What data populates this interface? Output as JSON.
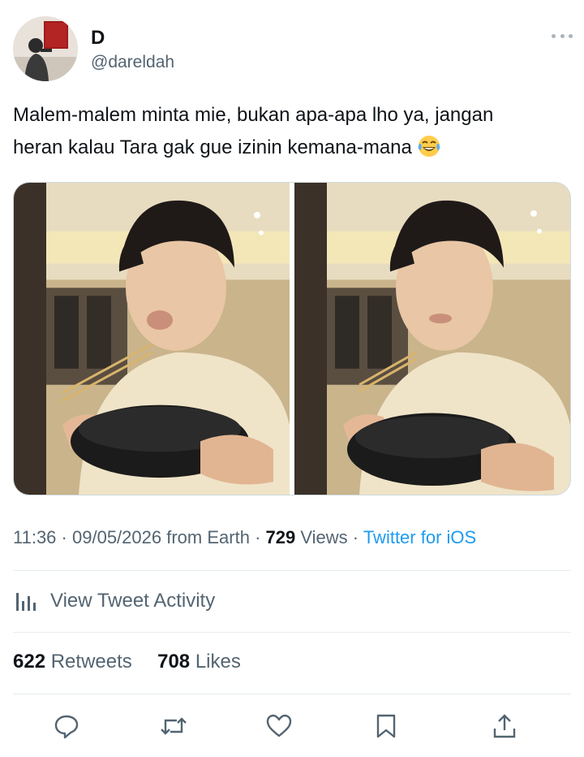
{
  "tweet": {
    "author": {
      "display_name": "D",
      "handle": "@dareldah"
    },
    "text_line1": "Malem-malem minta mie, bukan apa-apa lho ya, jangan",
    "text_line2": "heran kalau Tara gak gue izinin kemana-mana",
    "emoji": "face-with-tears-of-joy",
    "time": "11:36",
    "date": "09/05/2026",
    "location": "from Earth",
    "views_count": "729",
    "views_label": "Views",
    "source": "Twitter for iOS",
    "activity_label": "View Tweet Activity",
    "retweets_count": "622",
    "retweets_label": "Retweets",
    "likes_count": "708",
    "likes_label": "Likes"
  },
  "icons": {
    "more": "more-horizontal-icon",
    "activity": "analytics-bars-icon",
    "reply": "reply-bubble-icon",
    "retweet": "retweet-icon",
    "like": "heart-icon",
    "bookmark": "bookmark-icon",
    "share": "share-icon"
  },
  "colors": {
    "text_primary": "#0f1419",
    "text_secondary": "#536471",
    "link": "#1d9bf0",
    "divider": "#e6ecf0"
  }
}
